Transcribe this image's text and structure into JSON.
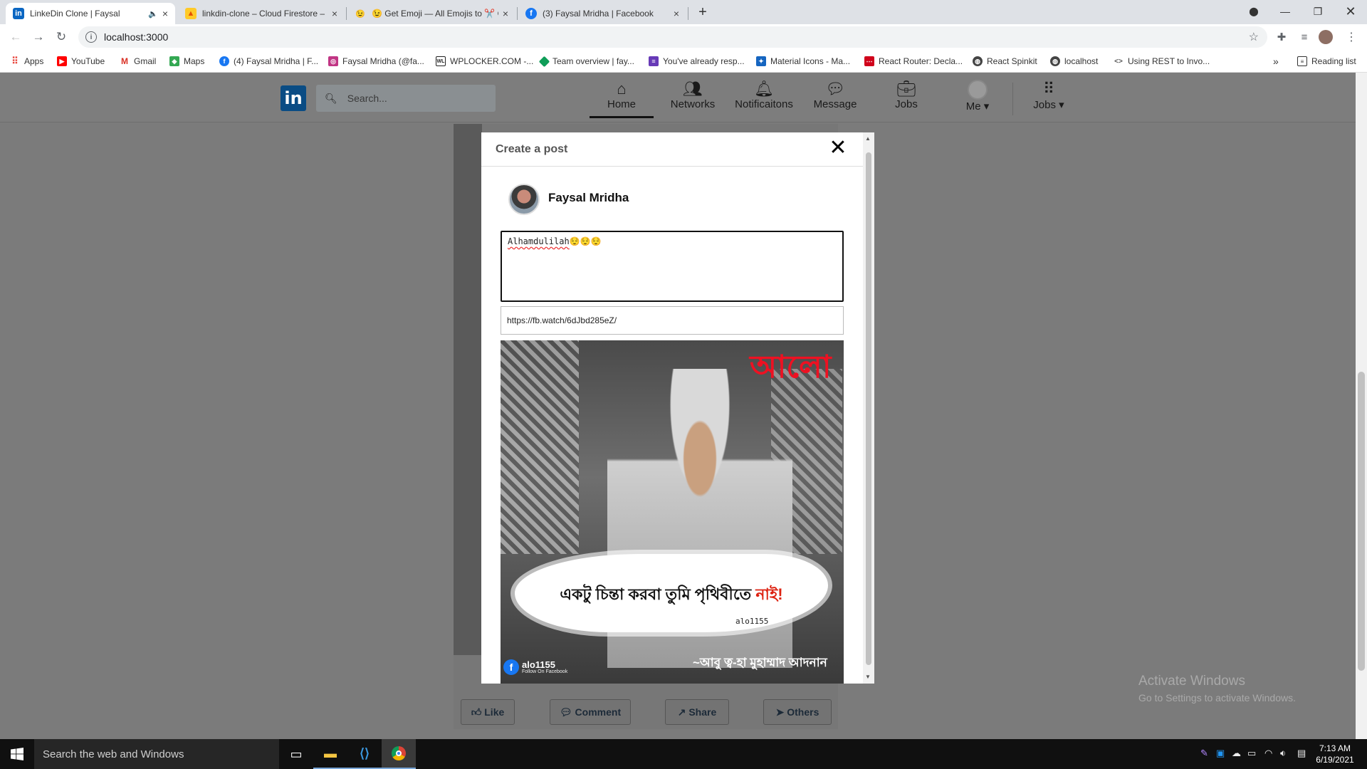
{
  "browser": {
    "tabs": [
      {
        "title": "LinkeDin Clone | Faysal",
        "favicon": "linkedin-icon",
        "audio": true,
        "active": true
      },
      {
        "title": "linkdin-clone – Cloud Firestore – ",
        "favicon": "firebase-icon"
      },
      {
        "title": "😉 Get Emoji — All Emojis to ✂️ C",
        "favicon": "emoji-icon"
      },
      {
        "title": "(3) Faysal Mridha | Facebook",
        "favicon": "facebook-icon"
      }
    ],
    "new_tab": "+",
    "url": "localhost:3000",
    "bookmarks": [
      {
        "label": "Apps",
        "color": "#e8453c"
      },
      {
        "label": "YouTube",
        "color": "#ff0000"
      },
      {
        "label": "Gmail",
        "color": "#d93025"
      },
      {
        "label": "Maps",
        "color": "#34a853"
      },
      {
        "label": "(4) Faysal Mridha | F...",
        "color": "#1877f2"
      },
      {
        "label": "Faysal Mridha (@fa...",
        "color": "#c13584"
      },
      {
        "label": "WPLOCKER.COM -...",
        "color": "#222222"
      },
      {
        "label": "Team overview | fay...",
        "color": "#0f9d58"
      },
      {
        "label": "You've already resp...",
        "color": "#673ab7"
      },
      {
        "label": "Material Icons - Ma...",
        "color": "#1565c0"
      },
      {
        "label": "React Router: Decla...",
        "color": "#d0021b"
      },
      {
        "label": "React Spinkit",
        "color": "#444444"
      },
      {
        "label": "localhost",
        "color": "#444444"
      },
      {
        "label": "Using REST to Invo...",
        "color": "#555555"
      }
    ],
    "bookmarks_more": "»",
    "reading_list": "Reading list"
  },
  "linkedin": {
    "logo": "in",
    "search_placeholder": "Search...",
    "nav": [
      {
        "label": "Home",
        "icon": "home-icon",
        "active": true
      },
      {
        "label": "Networks",
        "icon": "people-icon"
      },
      {
        "label": "Notificaitons",
        "icon": "bell-icon"
      },
      {
        "label": "Message",
        "icon": "chat-icon"
      },
      {
        "label": "Jobs",
        "icon": "briefcase-icon"
      },
      {
        "label": "Me",
        "icon": "avatar-icon"
      },
      {
        "label": "Jobs",
        "icon": "grid-icon"
      }
    ],
    "feed_actions": [
      "Like",
      "Comment",
      "Share",
      "Others"
    ]
  },
  "modal": {
    "title": "Create a post",
    "close": "✕",
    "user_name": "Faysal Mridha",
    "post_text": "Alhamdulilah",
    "post_emojis": "😌😌😌",
    "video_url": "https://fb.watch/6dJbd285eZ/",
    "video": {
      "logo_text": "আলো",
      "caption_main": "একটু চিন্তা করবা তুমি পৃথিবীতে",
      "caption_red": "নাই!",
      "watermark": "alo1155",
      "credit": "~আবু ত্ব-হা মুহাম্মাদ আদনান",
      "fb_page": "alo1155",
      "fb_sub": "Follow On Facebook"
    }
  },
  "watermark": {
    "line1": "Activate Windows",
    "line2": "Go to Settings to activate Windows."
  },
  "taskbar": {
    "search_placeholder": "Search the web and Windows",
    "time": "7:13 AM",
    "date": "6/19/2021"
  }
}
